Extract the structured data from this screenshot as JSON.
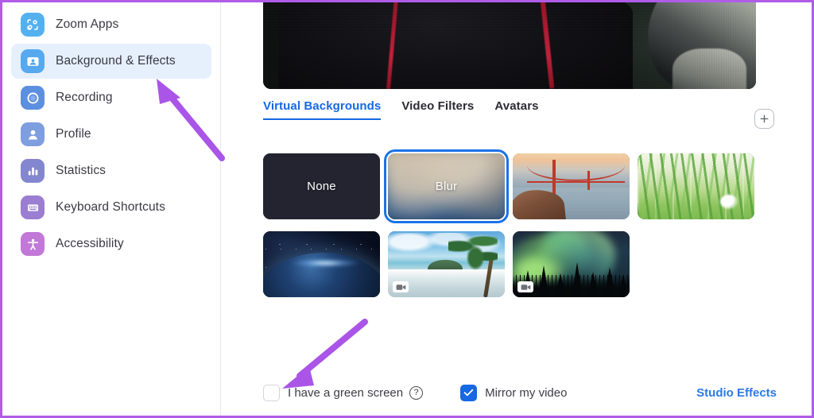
{
  "sidebar": {
    "items": [
      {
        "label": "Zoom Apps",
        "icon": "zoom-apps-icon",
        "color": "#53b1f0",
        "active": false
      },
      {
        "label": "Background & Effects",
        "icon": "background-effects-icon",
        "color": "#57a9ef",
        "active": true
      },
      {
        "label": "Recording",
        "icon": "recording-icon",
        "color": "#5d8fe0",
        "active": false
      },
      {
        "label": "Profile",
        "icon": "profile-icon",
        "color": "#7e9ee0",
        "active": false
      },
      {
        "label": "Statistics",
        "icon": "statistics-icon",
        "color": "#8387cf",
        "active": false
      },
      {
        "label": "Keyboard Shortcuts",
        "icon": "keyboard-icon",
        "color": "#9b7ed2",
        "active": false
      },
      {
        "label": "Accessibility",
        "icon": "accessibility-icon",
        "color": "#c278d8",
        "active": false
      }
    ]
  },
  "main": {
    "tabs": [
      {
        "label": "Virtual Backgrounds",
        "active": true
      },
      {
        "label": "Video Filters",
        "active": false
      },
      {
        "label": "Avatars",
        "active": false
      }
    ],
    "add_button": "+",
    "backgrounds": [
      {
        "label": "None",
        "art": "none",
        "selected": false,
        "video": false
      },
      {
        "label": "Blur",
        "art": "blur",
        "selected": true,
        "video": false
      },
      {
        "label": "",
        "art": "bridge",
        "selected": false,
        "video": false
      },
      {
        "label": "",
        "art": "grass",
        "selected": false,
        "video": false
      },
      {
        "label": "",
        "art": "earth",
        "selected": false,
        "video": false
      },
      {
        "label": "",
        "art": "beach",
        "selected": false,
        "video": true
      },
      {
        "label": "",
        "art": "aurora",
        "selected": false,
        "video": true
      }
    ],
    "controls": {
      "green_screen_label": "I have a green screen",
      "green_screen_checked": false,
      "help_glyph": "?",
      "mirror_label": "Mirror my video",
      "mirror_checked": true,
      "studio_effects_label": "Studio Effects"
    }
  },
  "annotations": {
    "arrow_color": "#aa55e8",
    "border_color": "#b05ce8",
    "arrows": [
      {
        "name": "arrow-to-background-effects",
        "points_at": "Background & Effects"
      },
      {
        "name": "arrow-to-green-screen-checkbox",
        "points_at": "I have a green screen"
      }
    ]
  },
  "colors": {
    "accent_blue": "#1668e3",
    "link_blue": "#2a7ae9",
    "active_nav_bg": "#e6f0fd"
  }
}
